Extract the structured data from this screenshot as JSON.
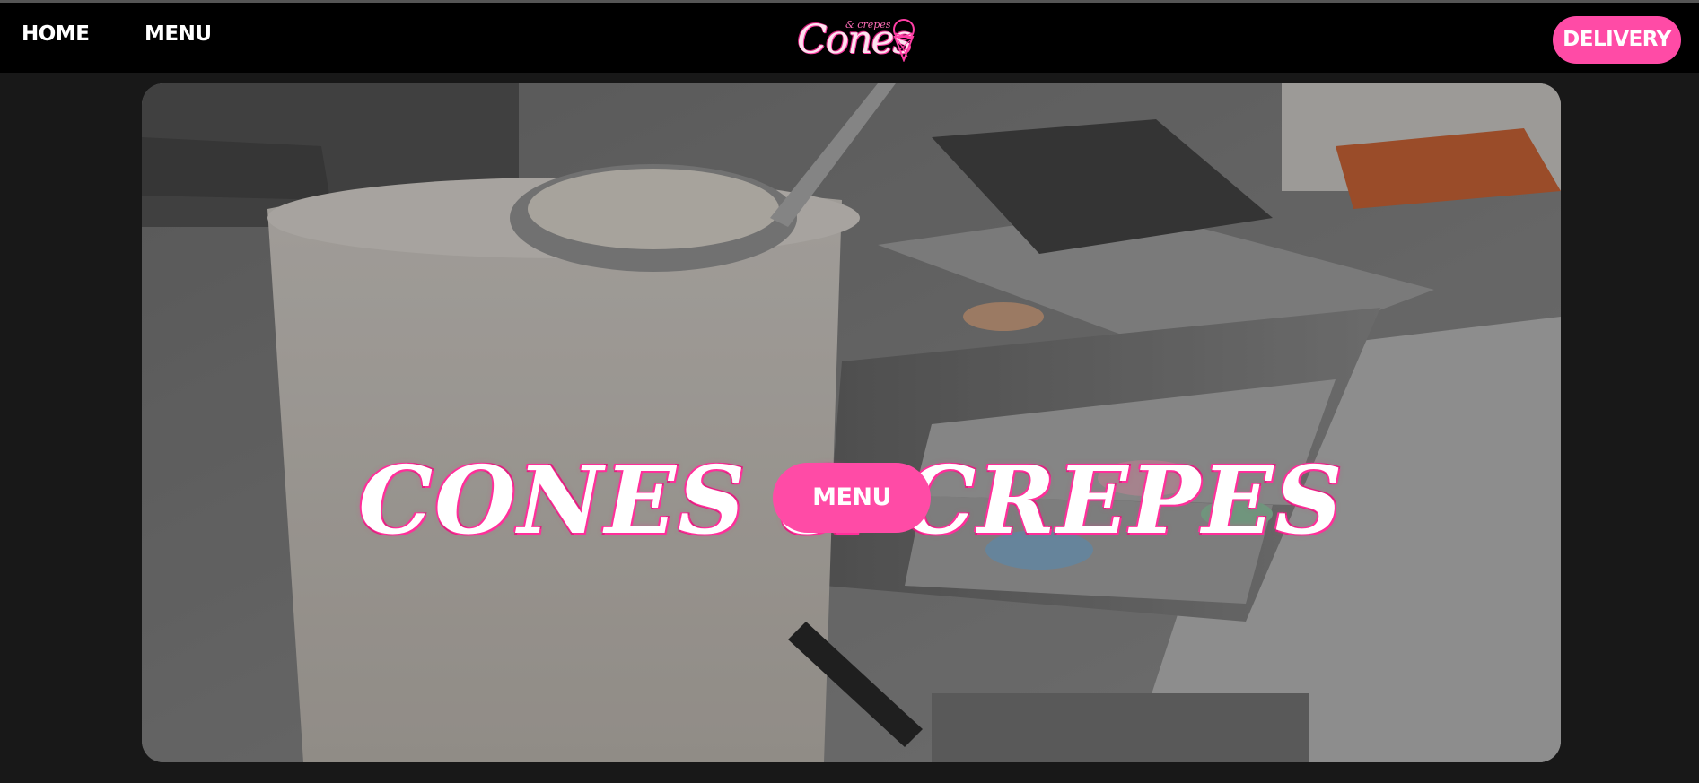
{
  "nav": {
    "home_label": "HOME",
    "menu_label": "MENU",
    "delivery_label": "DELIVERY"
  },
  "logo": {
    "script_text": "Cones",
    "small_text": "& crepes"
  },
  "hero": {
    "title": "CONES & CREPES",
    "menu_button_label": "MENU"
  },
  "colors": {
    "accent_pink": "#ff4ba6",
    "navbar_bg": "#000000",
    "page_bg": "#181818"
  }
}
